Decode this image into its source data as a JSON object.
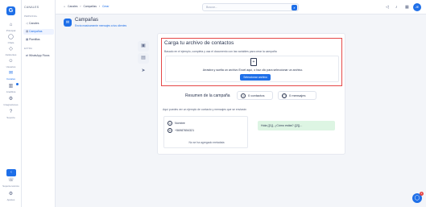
{
  "rail": {
    "logo": "G",
    "items": [
      {
        "icon": "home-icon",
        "glyph": "⌂",
        "label": "Principal"
      },
      {
        "icon": "chat-icon",
        "glyph": "◯",
        "label": "Chats"
      },
      {
        "icon": "robot-icon",
        "glyph": "◇",
        "label": "Asistentes"
      },
      {
        "icon": "users-icon",
        "glyph": "☺",
        "label": "Usuarios"
      },
      {
        "icon": "megaphone-icon",
        "glyph": "✉",
        "label": "Canales"
      },
      {
        "icon": "analytics-icon",
        "glyph": "▥",
        "label": "Analítica"
      },
      {
        "icon": "integrations-icon",
        "glyph": "⚙",
        "label": "Integraciones"
      },
      {
        "icon": "help-icon",
        "glyph": "?",
        "label": "Soporte"
      }
    ],
    "support_label": "Soporte técnico",
    "settings_label": "Ajustes"
  },
  "subnav": {
    "header": "CANALES",
    "section_personal": "PERSONAL",
    "items_personal": [
      "Canales",
      "Campañas",
      "Plantillas"
    ],
    "section_extra": "EXTRA",
    "items_extra": [
      "WhatsApp Flows"
    ]
  },
  "topbar": {
    "crumbs": [
      "Canales",
      "Campañas",
      "Crear"
    ],
    "search_placeholder": "Buscar..."
  },
  "page": {
    "title": "Campañas",
    "subtitle": "Envía masivamente mensajes a tus clientes"
  },
  "upload": {
    "title": "Carga tu archivo de contactos",
    "description": "Basado en el ejemplo, completa y usa el documento con las variables para crear la campaña",
    "drop_text": "Arrastra y suelta un archivo Excel aquí, o haz clic para seleccionar un archivo.",
    "button_label": "Seleccionar archivo"
  },
  "summary": {
    "title": "Resumen de la campaña",
    "contacts_label": "0 contactos",
    "messages_label": "0 mensajes",
    "note": "Aquí puedes ver un ejemplo de contacto y mensajes que se enviarán",
    "contact_name": "Nombre",
    "contact_phone": "+56987654321",
    "no_metadata": "No se ha agregado metadata",
    "message_preview": "Hola {{1}}, ¿Cómo estás? {{2}}..."
  },
  "fab_badge": "1",
  "colors": {
    "accent": "#1e6fe8",
    "highlight_border": "#e54848",
    "bubble": "#ddf5e3"
  }
}
